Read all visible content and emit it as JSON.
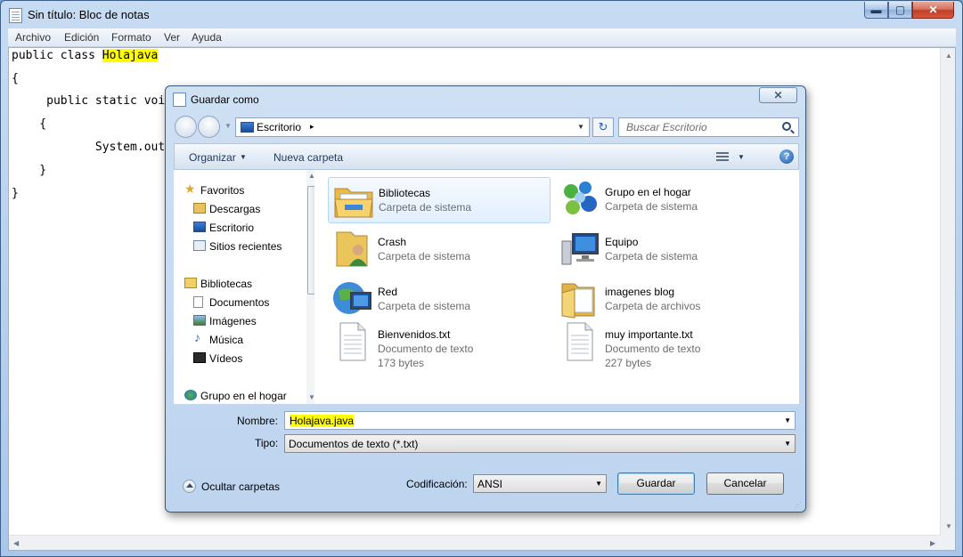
{
  "notepad": {
    "title": "Sin título: Bloc de notas",
    "window_buttons": {
      "minimize": "▬",
      "maximize": "▢",
      "close": "✕"
    },
    "menu": [
      "Archivo",
      "Edición",
      "Formato",
      "Ver",
      "Ayuda"
    ],
    "code": {
      "line1_prefix": "public class ",
      "line1_class": "Holajava",
      "line2": "{",
      "line3": "     public static voi",
      "line4": "    {",
      "line5": "            System.out.",
      "line6": "    }",
      "line7": "}"
    },
    "highlight_color": "#ffff00"
  },
  "dialog": {
    "title": "Guardar como",
    "close_label": "✕",
    "address": {
      "location": "Escritorio",
      "separator": "▸",
      "dropdown": "▼"
    },
    "search": {
      "placeholder": "Buscar Escritorio"
    },
    "toolbar": {
      "organize": "Organizar",
      "organize_arrow": "▼",
      "new_folder": "Nueva carpeta",
      "view_arrow": "▼",
      "help": "?"
    },
    "nav": {
      "favorites": "Favoritos",
      "downloads": "Descargas",
      "desktop": "Escritorio",
      "recent": "Sitios recientes",
      "libraries": "Bibliotecas",
      "documents": "Documentos",
      "images": "Imágenes",
      "music": "Música",
      "videos": "Vídeos",
      "homegroup": "Grupo en el hogar"
    },
    "files": [
      {
        "name": "Bibliotecas",
        "type": "Carpeta de sistema",
        "icon": "libraries-folder"
      },
      {
        "name": "Grupo en el hogar",
        "type": "Carpeta de sistema",
        "icon": "homegroup"
      },
      {
        "name": "Crash",
        "type": "Carpeta de sistema",
        "icon": "user-folder"
      },
      {
        "name": "Equipo",
        "type": "Carpeta de sistema",
        "icon": "computer"
      },
      {
        "name": "Red",
        "type": "Carpeta de sistema",
        "icon": "network"
      },
      {
        "name": "imagenes blog",
        "type": "Carpeta de archivos",
        "icon": "folder"
      },
      {
        "name": "Bienvenidos.txt",
        "type": "Documento de texto",
        "size": "173 bytes",
        "icon": "text-document"
      },
      {
        "name": "muy importante.txt",
        "type": "Documento de texto",
        "size": "227 bytes",
        "icon": "text-document"
      }
    ],
    "form": {
      "name_label": "Nombre:",
      "name_value": "Holajava.java",
      "type_label": "Tipo:",
      "type_value": "Documentos de texto (*.txt)",
      "encoding_label": "Codificación:",
      "encoding_value": "ANSI"
    },
    "hide_folders": "Ocultar carpetas",
    "buttons": {
      "save": "Guardar",
      "cancel": "Cancelar"
    }
  }
}
